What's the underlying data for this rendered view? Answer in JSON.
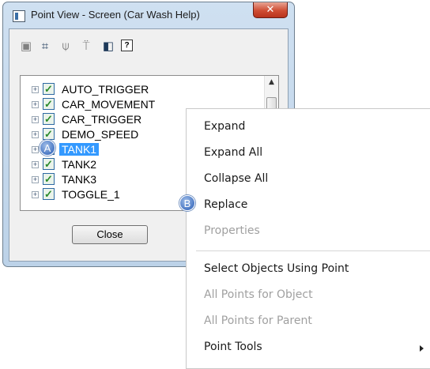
{
  "window": {
    "title": "Point View - Screen (Car Wash Help)",
    "close_glyph": "✕"
  },
  "toolbar": {
    "icons": [
      "properties-icon",
      "tree-view-icon",
      "filter-icon",
      "filter-clear-icon",
      "copy-icon",
      "help-icon"
    ],
    "help_glyph": "?"
  },
  "tree": {
    "items": [
      {
        "label": "AUTO_TRIGGER",
        "checked": true,
        "selected": false
      },
      {
        "label": "CAR_MOVEMENT",
        "checked": true,
        "selected": false
      },
      {
        "label": "CAR_TRIGGER",
        "checked": true,
        "selected": false
      },
      {
        "label": "DEMO_SPEED",
        "checked": true,
        "selected": false
      },
      {
        "label": "TANK1",
        "checked": true,
        "selected": true
      },
      {
        "label": "TANK2",
        "checked": true,
        "selected": false
      },
      {
        "label": "TANK3",
        "checked": true,
        "selected": false
      },
      {
        "label": "TOGGLE_1",
        "checked": true,
        "selected": false
      }
    ]
  },
  "close_button": {
    "label": "Close"
  },
  "context_menu": {
    "items": [
      {
        "label": "Expand",
        "enabled": true
      },
      {
        "label": "Expand All",
        "enabled": true
      },
      {
        "label": "Collapse All",
        "enabled": true
      },
      {
        "label": "Replace",
        "enabled": true
      },
      {
        "label": "Properties",
        "enabled": false
      },
      {
        "label": "Select Objects Using Point",
        "enabled": true
      },
      {
        "label": "All Points for Object",
        "enabled": false
      },
      {
        "label": "All Points for Parent",
        "enabled": false
      },
      {
        "label": "Point Tools",
        "enabled": true,
        "submenu": true
      }
    ]
  },
  "callouts": {
    "a": "A",
    "b": "B"
  },
  "colors": {
    "selection": "#3399ff",
    "callout": "#4a78c4",
    "disabled_text": "#a0a0a0"
  }
}
